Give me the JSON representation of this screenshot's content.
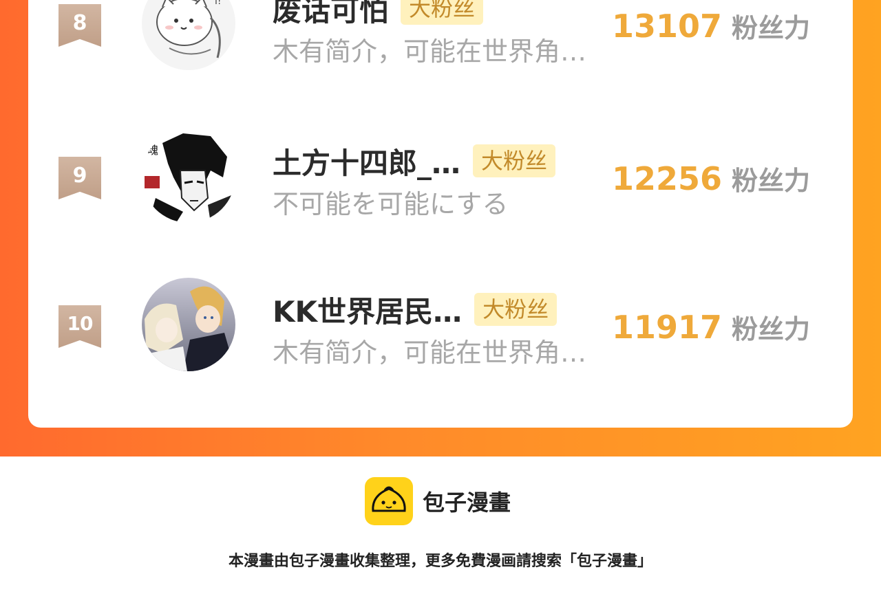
{
  "rows": [
    {
      "rank": "8",
      "name": "废话可怕",
      "badge": "大粉丝",
      "bio": "木有简介，可能在世界角…",
      "score": "13107",
      "unit": "粉丝力"
    },
    {
      "rank": "9",
      "name": "土方十四郎_…",
      "badge": "大粉丝",
      "bio": "不可能を可能にする",
      "score": "12256",
      "unit": "粉丝力"
    },
    {
      "rank": "10",
      "name": "KK世界居民…",
      "badge": "大粉丝",
      "bio": "木有简介，可能在世界角…",
      "score": "11917",
      "unit": "粉丝力"
    }
  ],
  "footer": {
    "brand": "包子漫畫",
    "note": "本漫畫由包子漫畫收集整理，更多免費漫画請搜索「包子漫畫」"
  },
  "icons": {
    "rank_ribbon": "ribbon-badge-icon",
    "logo": "steamed-bun-icon"
  },
  "colors": {
    "frame_start": "#ff6a2e",
    "frame_end": "#ffa321",
    "score": "#efa93a",
    "badge_bg": "#fff1bd",
    "badge_text": "#c28a2a",
    "rank_ribbon": "#c8a892",
    "logo_bg": "#ffd21a"
  }
}
